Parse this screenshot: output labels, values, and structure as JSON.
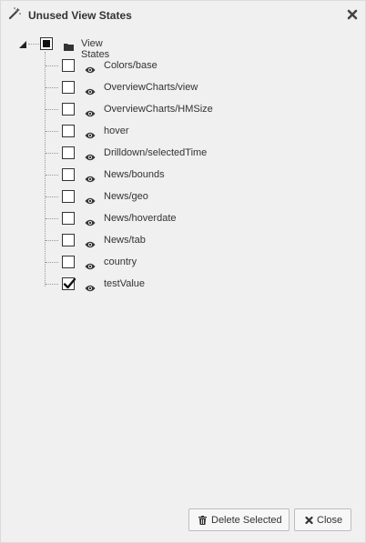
{
  "dialog": {
    "title": "Unused View States",
    "title_icon": "magic-wand-icon",
    "close_icon": "close-icon"
  },
  "tree": {
    "root": {
      "label": "View States",
      "state": "partial",
      "expander_icon": "tree-expanded-triangle-icon",
      "folder_icon": "folder-icon"
    },
    "items": [
      {
        "label": "Colors/base",
        "checked": false
      },
      {
        "label": "OverviewCharts/view",
        "checked": false
      },
      {
        "label": "OverviewCharts/HMSize",
        "checked": false
      },
      {
        "label": "hover",
        "checked": false
      },
      {
        "label": "Drilldown/selectedTime",
        "checked": false
      },
      {
        "label": "News/bounds",
        "checked": false
      },
      {
        "label": "News/geo",
        "checked": false
      },
      {
        "label": "News/hoverdate",
        "checked": false
      },
      {
        "label": "News/tab",
        "checked": false
      },
      {
        "label": "country",
        "checked": false
      },
      {
        "label": "testValue",
        "checked": true
      }
    ],
    "item_icon": "eye-icon"
  },
  "footer": {
    "delete_label": "Delete Selected",
    "delete_icon": "trash-icon",
    "close_label": "Close",
    "close_icon": "close-x-icon"
  }
}
